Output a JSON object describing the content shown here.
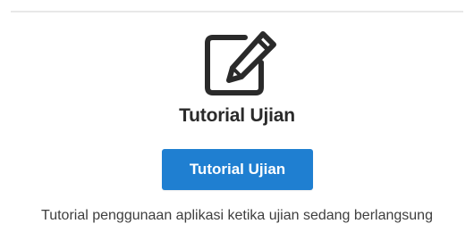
{
  "card": {
    "icon": "edit-icon",
    "title": "Tutorial Ujian",
    "button_label": "Tutorial Ujian",
    "description": "Tutorial penggunaan aplikasi ketika ujian sedang berlangsung"
  },
  "colors": {
    "button_bg": "#1f7fd1",
    "button_text": "#ffffff",
    "title_text": "#2a2a2a",
    "description_text": "#3e3e3e",
    "icon": "#2a2a2a",
    "divider": "#e8e8e8"
  }
}
